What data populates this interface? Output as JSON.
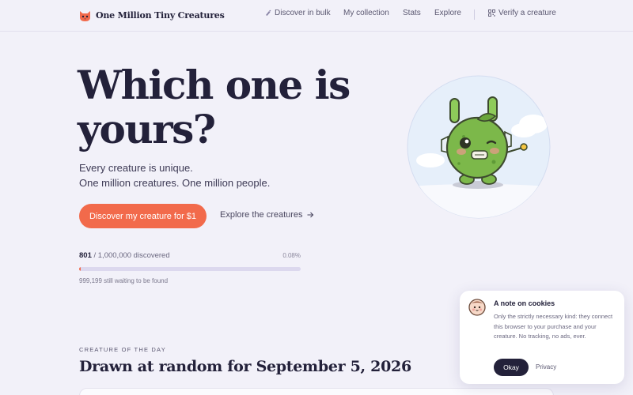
{
  "nav": {
    "brand": "One Million Tiny Creatures",
    "brand_icon": "cat-face-logo",
    "links": [
      {
        "label": "Discover in bulk",
        "icon": "sparkle-icon"
      },
      {
        "label": "My collection"
      },
      {
        "label": "Stats"
      },
      {
        "label": "Explore"
      },
      {
        "label": "Verify a creature",
        "icon": "qr-code-icon"
      }
    ]
  },
  "hero": {
    "title": "Which one is yours?",
    "subtitle_line1": "Every creature is unique.",
    "subtitle_line2": "One million creatures. One million people.",
    "cta_label": "Discover my creature for $1",
    "explore_label": "Explore the creatures",
    "explore_icon": "arrow-right-icon"
  },
  "progress": {
    "discovered": "801",
    "total": "/ 1,000,000 discovered",
    "percent_label": "0.08%",
    "fraction": 0.0008,
    "waiting": "999,199 still waiting to be found"
  },
  "creature_of_day": {
    "kicker": "CREATURE OF THE DAY",
    "title": "Drawn at random for September 5, 2026"
  },
  "cookie": {
    "title": "A note on cookies",
    "body": "Only the strictly necessary kind: they connect this browser to your purchase and your creature. No tracking, no ads, ever.",
    "ok_label": "Okay",
    "privacy_label": "Privacy"
  },
  "colors": {
    "background": "#f2f1f9",
    "accent": "#f26a4b",
    "ink": "#23213a",
    "creature_green": "#7cb84a"
  }
}
